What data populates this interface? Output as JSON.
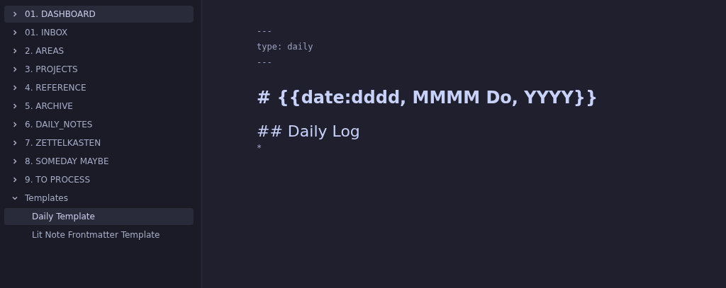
{
  "sidebar": {
    "items": [
      {
        "label": "01. DASHBOARD",
        "kind": "folder",
        "expanded": false,
        "selected": true
      },
      {
        "label": "01. INBOX",
        "kind": "folder",
        "expanded": false,
        "selected": false
      },
      {
        "label": "2. AREAS",
        "kind": "folder",
        "expanded": false,
        "selected": false
      },
      {
        "label": "3. PROJECTS",
        "kind": "folder",
        "expanded": false,
        "selected": false
      },
      {
        "label": "4. REFERENCE",
        "kind": "folder",
        "expanded": false,
        "selected": false
      },
      {
        "label": "5. ARCHIVE",
        "kind": "folder",
        "expanded": false,
        "selected": false
      },
      {
        "label": "6. DAILY_NOTES",
        "kind": "folder",
        "expanded": false,
        "selected": false
      },
      {
        "label": "7. ZETTELKASTEN",
        "kind": "folder",
        "expanded": false,
        "selected": false
      },
      {
        "label": "8. SOMEDAY MAYBE",
        "kind": "folder",
        "expanded": false,
        "selected": false
      },
      {
        "label": "9. TO PROCESS",
        "kind": "folder",
        "expanded": false,
        "selected": false
      },
      {
        "label": "Templates",
        "kind": "folder",
        "expanded": true,
        "selected": false,
        "children": [
          {
            "label": "Daily Template",
            "kind": "file",
            "selected": true
          },
          {
            "label": "Lit Note Frontmatter Template",
            "kind": "file",
            "selected": false
          }
        ]
      }
    ]
  },
  "editor": {
    "lines": [
      {
        "kind": "code",
        "text": "---"
      },
      {
        "kind": "code",
        "text": "type: daily"
      },
      {
        "kind": "code",
        "text": "---"
      },
      {
        "kind": "h1",
        "text": "# {{date:dddd, MMMM Do, YYYY}}"
      },
      {
        "kind": "h2",
        "text": "## Daily Log"
      },
      {
        "kind": "code",
        "text": "*"
      }
    ]
  }
}
